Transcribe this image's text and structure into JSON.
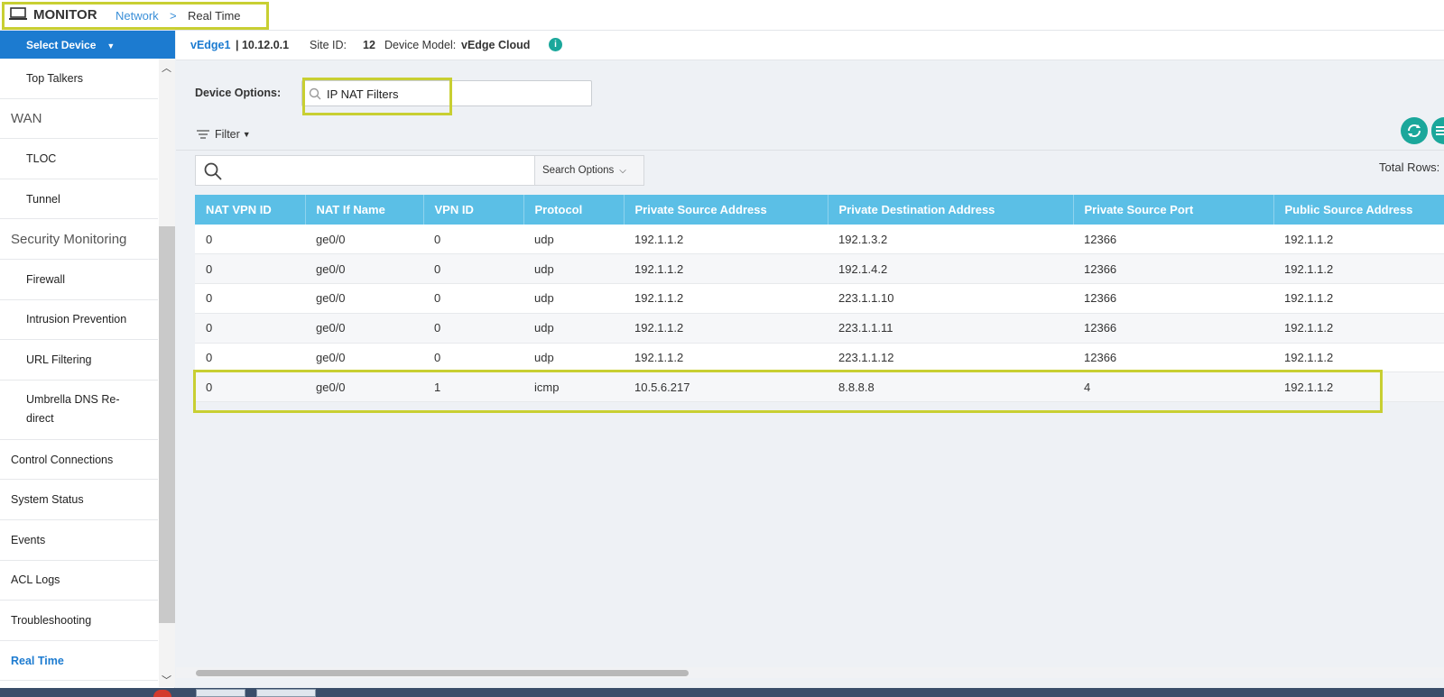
{
  "header": {
    "title": "MONITOR",
    "breadcrumb": {
      "network": "Network",
      "separator": ">",
      "current": "Real Time"
    }
  },
  "sidebar": {
    "select_device": "Select Device",
    "items": [
      {
        "label": "Top Talkers",
        "kind": "sub"
      },
      {
        "label": "WAN",
        "kind": "group"
      },
      {
        "label": "TLOC",
        "kind": "sub"
      },
      {
        "label": "Tunnel",
        "kind": "sub"
      },
      {
        "label": "Security Monitoring",
        "kind": "group"
      },
      {
        "label": "Firewall",
        "kind": "sub"
      },
      {
        "label": "Intrusion Prevention",
        "kind": "sub"
      },
      {
        "label": "URL Filtering",
        "kind": "sub"
      },
      {
        "label": "Umbrella DNS Re-direct",
        "kind": "sub-tall"
      },
      {
        "label": "Control Connections",
        "kind": "top"
      },
      {
        "label": "System Status",
        "kind": "top"
      },
      {
        "label": "Events",
        "kind": "top"
      },
      {
        "label": "ACL Logs",
        "kind": "top"
      },
      {
        "label": "Troubleshooting",
        "kind": "top"
      },
      {
        "label": "Real Time",
        "kind": "active"
      }
    ]
  },
  "device": {
    "name": "vEdge1",
    "ip": "| 10.12.0.1",
    "site_label": "Site ID:",
    "site_id": "12",
    "model_label": "Device Model:",
    "model": "vEdge Cloud",
    "info_icon": "i"
  },
  "device_options": {
    "label": "Device Options:",
    "value": "IP NAT Filters"
  },
  "filter": {
    "label": "Filter"
  },
  "search": {
    "placeholder": "",
    "options_label": "Search Options"
  },
  "total_rows_label": "Total Rows:",
  "table": {
    "columns": [
      "NAT VPN ID",
      "NAT If Name",
      "VPN ID",
      "Protocol",
      "Private Source Address",
      "Private Destination Address",
      "Private Source Port",
      "Public Source Address"
    ],
    "rows": [
      [
        "0",
        "ge0/0",
        "0",
        "udp",
        "192.1.1.2",
        "192.1.3.2",
        "12366",
        "192.1.1.2"
      ],
      [
        "0",
        "ge0/0",
        "0",
        "udp",
        "192.1.1.2",
        "192.1.4.2",
        "12366",
        "192.1.1.2"
      ],
      [
        "0",
        "ge0/0",
        "0",
        "udp",
        "192.1.1.2",
        "223.1.1.10",
        "12366",
        "192.1.1.2"
      ],
      [
        "0",
        "ge0/0",
        "0",
        "udp",
        "192.1.1.2",
        "223.1.1.11",
        "12366",
        "192.1.1.2"
      ],
      [
        "0",
        "ge0/0",
        "0",
        "udp",
        "192.1.1.2",
        "223.1.1.12",
        "12366",
        "192.1.1.2"
      ],
      [
        "0",
        "ge0/0",
        "1",
        "icmp",
        "10.5.6.217",
        "8.8.8.8",
        "4",
        "192.1.1.2"
      ]
    ]
  },
  "colors": {
    "accent_blue": "#1c7bd0",
    "table_header": "#5bbfe6",
    "teal": "#1aa79b",
    "highlight": "#c8cf32"
  },
  "icons": {
    "monitor": "monitor-icon",
    "refresh": "refresh-icon",
    "menu": "menu-icon",
    "search": "search-icon",
    "filter": "filter-icon"
  }
}
